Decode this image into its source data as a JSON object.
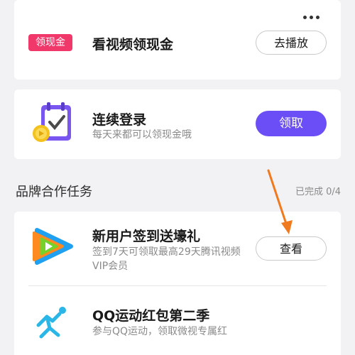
{
  "video_card": {
    "badge": "领现金",
    "title": "看视频领现金",
    "button": "去播放"
  },
  "login_card": {
    "title": "连续登录",
    "subtitle": "每天来都可以领现金哦",
    "button": "领取"
  },
  "brand_section": {
    "title": "品牌合作任务",
    "progress": "已完成 0/4"
  },
  "tasks": [
    {
      "title": "新用户签到送壕礼",
      "desc_line1": "签到7天可领取最高29天腾讯视频",
      "desc_line2": "VIP会员",
      "button": "查看",
      "icon": "tencent-video-icon"
    },
    {
      "title": "QQ运动红包第二季",
      "desc_line1": "参与QQ运动，领取微视专属红",
      "icon": "qq-sport-icon"
    }
  ],
  "colors": {
    "badge": "#f0386b",
    "primary_button": "#6b4ef5",
    "annotation_arrow": "#f07a1e"
  }
}
